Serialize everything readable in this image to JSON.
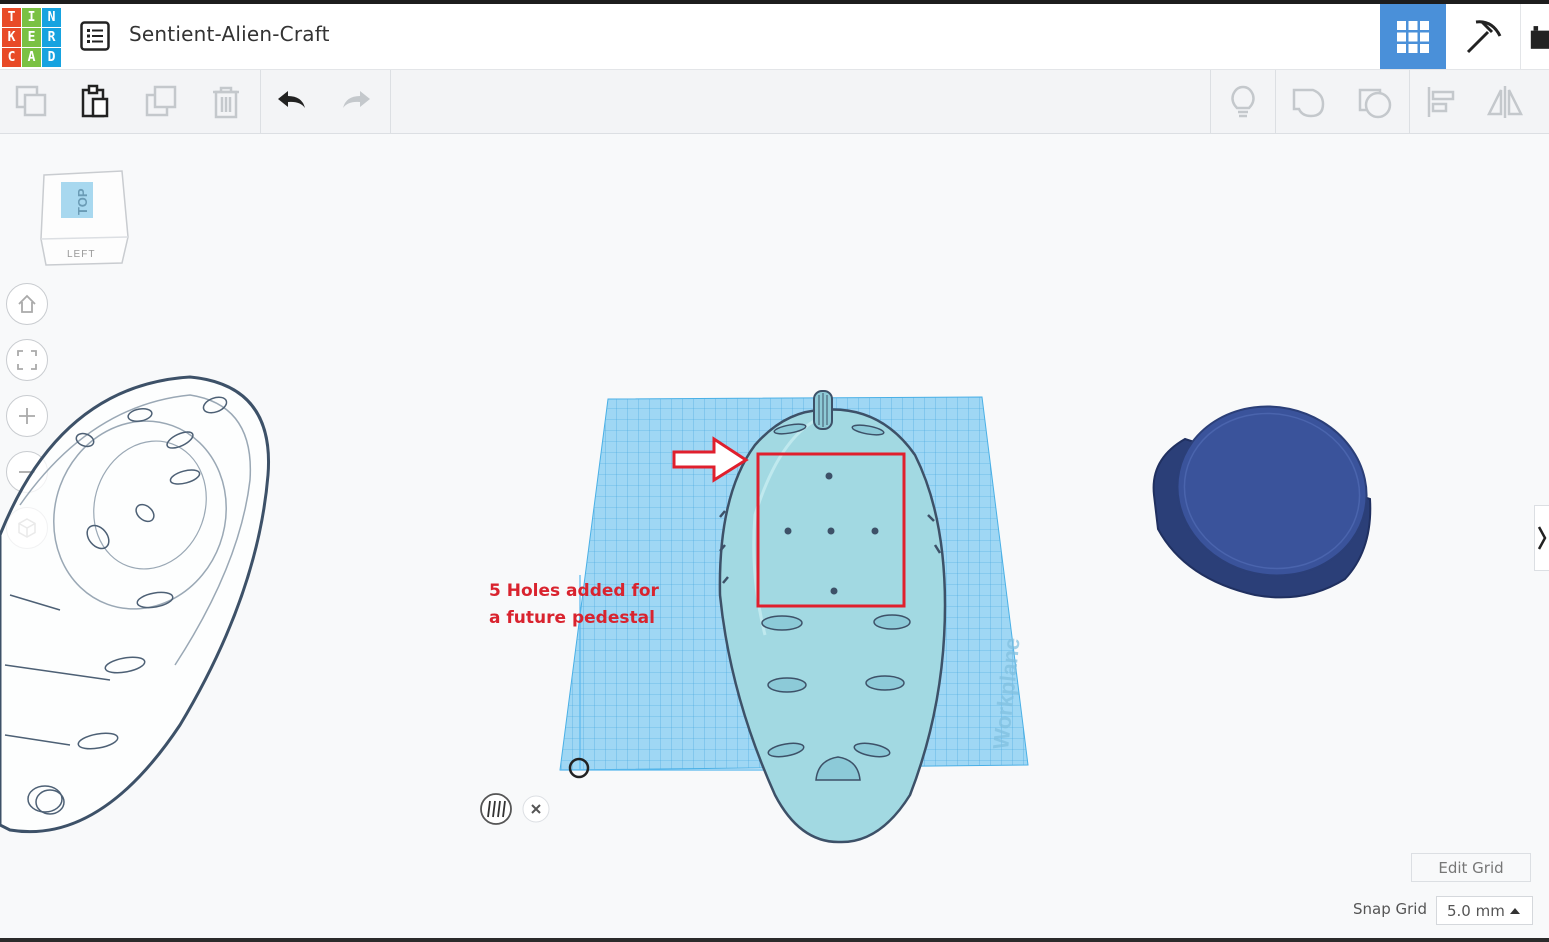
{
  "app": {
    "logo_letters": [
      "T",
      "I",
      "N",
      "K",
      "E",
      "R",
      "C",
      "A",
      "D"
    ],
    "project_title": "Sentient-Alien-Craft"
  },
  "header": {
    "icons": [
      "list-icon",
      "grid-view-icon",
      "pickaxe-icon",
      "bricks-icon"
    ],
    "active_view": "grid-view-icon",
    "accent_color": "#4a90d9"
  },
  "toolbar": {
    "left_tools": [
      "copy-icon",
      "paste-icon",
      "duplicate-icon",
      "delete-icon",
      "undo-icon",
      "redo-icon"
    ],
    "right_tools": [
      "light-bulb-icon",
      "shape-icon",
      "hole-icon",
      "align-icon",
      "mirror-icon"
    ]
  },
  "view_cube": {
    "top_label": "TOP",
    "left_label": "LEFT"
  },
  "nav_controls": [
    "home-icon",
    "fit-icon",
    "zoom-in-icon",
    "zoom-out-icon",
    "orthographic-icon"
  ],
  "annotation": {
    "line1": "5 Holes added for",
    "line2": "a future pedestal",
    "color": "#d9232e"
  },
  "workplane": {
    "label": "Workplane",
    "color": "#59b8ee"
  },
  "shapes": {
    "alien_color": "#9fd6df",
    "cylinder_color": "#3a539b"
  },
  "footer": {
    "edit_grid": "Edit Grid",
    "snap_grid_label": "Snap Grid",
    "snap_grid_value": "5.0 mm"
  }
}
